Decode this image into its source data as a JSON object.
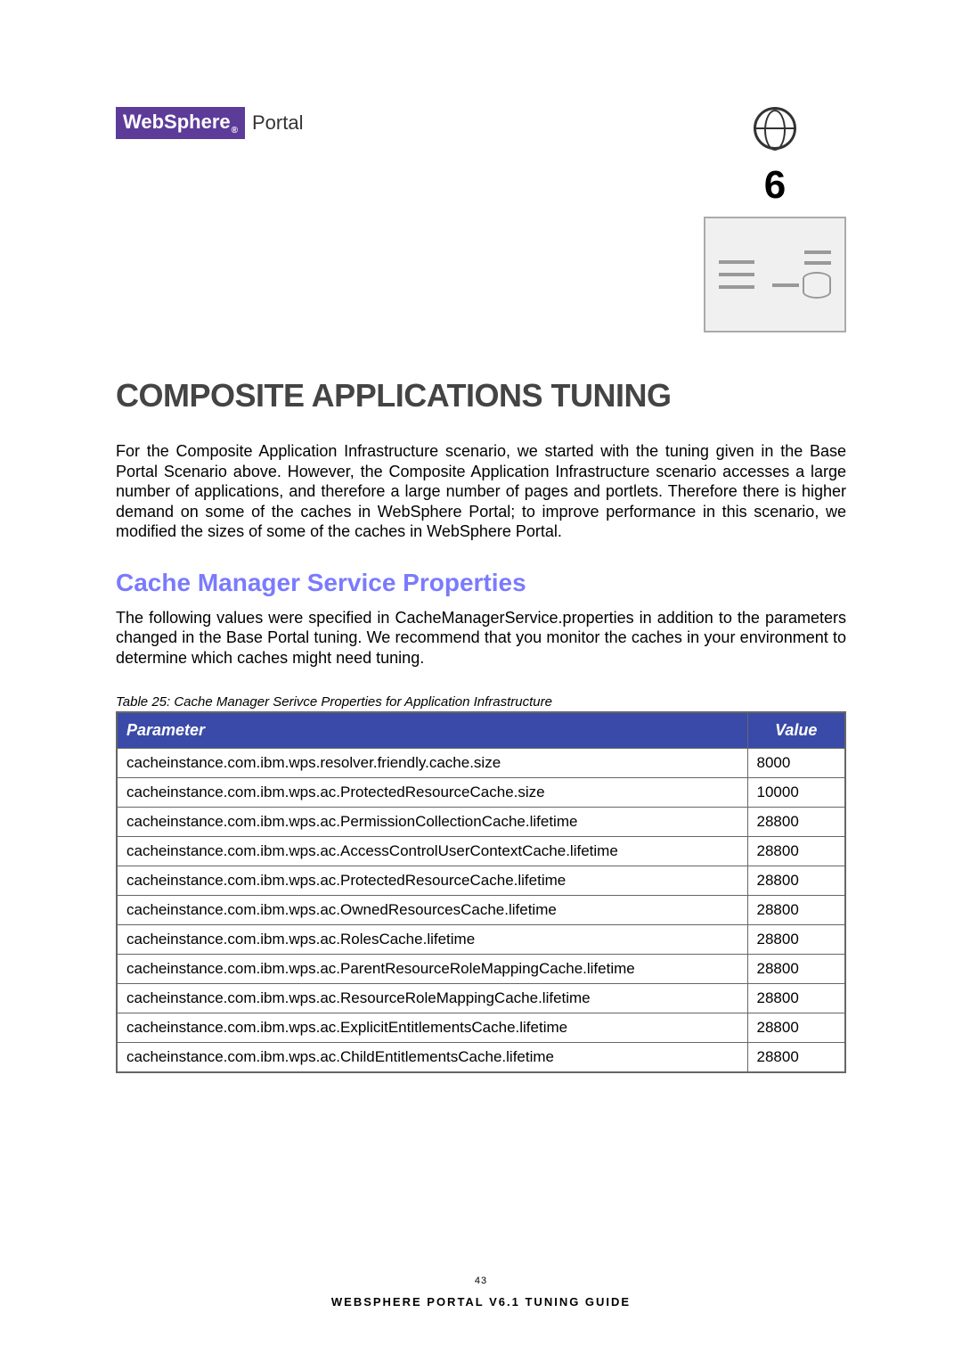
{
  "brand": {
    "websphere": "WebSphere",
    "portal": "Portal"
  },
  "chapter": {
    "number": "6"
  },
  "title": "COMPOSITE APPLICATIONS TUNING",
  "intro_paragraph": "For the Composite Application Infrastructure scenario, we started with the tuning given in the Base Portal Scenario above. However, the Composite Application Infrastructure scenario accesses a large number of applications, and therefore a large number of pages and portlets. Therefore there is higher demand on some of the caches in WebSphere Portal; to improve performance in this scenario, we modified the sizes of some of the caches in WebSphere Portal.",
  "section_heading": "Cache Manager Service Properties",
  "section_paragraph": "The following values were specified in CacheManagerService.properties in addition to the parameters changed in the Base Portal tuning. We recommend that you monitor the caches in your environment to determine which caches might need tuning.",
  "table_caption": "Table 25: Cache Manager Serivce Properties for Application Infrastructure",
  "table": {
    "headers": {
      "parameter": "Parameter",
      "value": "Value"
    },
    "rows": [
      {
        "parameter": "cacheinstance.com.ibm.wps.resolver.friendly.cache.size",
        "value": "8000"
      },
      {
        "parameter": "cacheinstance.com.ibm.wps.ac.ProtectedResourceCache.size",
        "value": "10000"
      },
      {
        "parameter": "cacheinstance.com.ibm.wps.ac.PermissionCollectionCache.lifetime",
        "value": "28800"
      },
      {
        "parameter": "cacheinstance.com.ibm.wps.ac.AccessControlUserContextCache.lifetime",
        "value": "28800"
      },
      {
        "parameter": "cacheinstance.com.ibm.wps.ac.ProtectedResourceCache.lifetime",
        "value": "28800"
      },
      {
        "parameter": "cacheinstance.com.ibm.wps.ac.OwnedResourcesCache.lifetime",
        "value": "28800"
      },
      {
        "parameter": "cacheinstance.com.ibm.wps.ac.RolesCache.lifetime",
        "value": "28800"
      },
      {
        "parameter": "cacheinstance.com.ibm.wps.ac.ParentResourceRoleMappingCache.lifetime",
        "value": "28800"
      },
      {
        "parameter": "cacheinstance.com.ibm.wps.ac.ResourceRoleMappingCache.lifetime",
        "value": "28800"
      },
      {
        "parameter": "cacheinstance.com.ibm.wps.ac.ExplicitEntitlementsCache.lifetime",
        "value": "28800"
      },
      {
        "parameter": "cacheinstance.com.ibm.wps.ac.ChildEntitlementsCache.lifetime",
        "value": "28800"
      }
    ]
  },
  "footer": {
    "page_number": "43",
    "doc_title": "WEBSPHERE PORTAL V6.1 TUNING GUIDE"
  }
}
